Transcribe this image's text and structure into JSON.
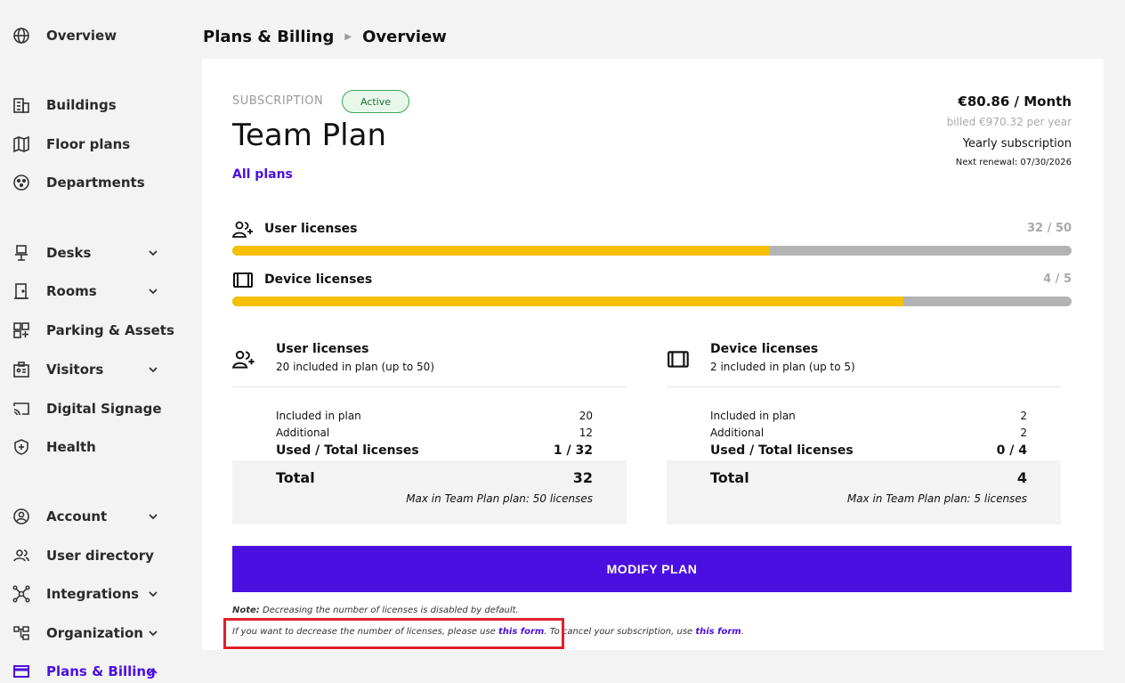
{
  "sidebar": {
    "items": [
      {
        "label": "Overview",
        "icon": "globe-icon",
        "chevron": false
      },
      {
        "label": "Buildings",
        "icon": "building-icon",
        "chevron": false
      },
      {
        "label": "Floor plans",
        "icon": "map-icon",
        "chevron": false
      },
      {
        "label": "Departments",
        "icon": "departments-icon",
        "chevron": false
      },
      {
        "label": "Desks",
        "icon": "desk-icon",
        "chevron": true
      },
      {
        "label": "Rooms",
        "icon": "room-icon",
        "chevron": true
      },
      {
        "label": "Parking & Assets",
        "icon": "parking-icon",
        "chevron": false
      },
      {
        "label": "Visitors",
        "icon": "visitors-icon",
        "chevron": true
      },
      {
        "label": "Digital Signage",
        "icon": "cast-icon",
        "chevron": false
      },
      {
        "label": "Health",
        "icon": "health-shield-icon",
        "chevron": false
      },
      {
        "label": "Account",
        "icon": "account-icon",
        "chevron": true
      },
      {
        "label": "User directory",
        "icon": "users-icon",
        "chevron": false
      },
      {
        "label": "Integrations",
        "icon": "integrations-icon",
        "chevron": true
      },
      {
        "label": "Organization",
        "icon": "organization-icon",
        "chevron": true
      },
      {
        "label": "Plans & Billing",
        "icon": "card-icon",
        "chevron": true
      }
    ]
  },
  "breadcrumb": {
    "parent": "Plans & Billing",
    "current": "Overview"
  },
  "subscription": {
    "label": "SUBSCRIPTION",
    "status": "Active",
    "plan_name": "Team Plan",
    "all_plans_link": "All plans",
    "price": "€80.86 / Month",
    "billed": "billed €970.32 per year",
    "term": "Yearly subscription",
    "renewal": "Next renewal: 07/30/2026"
  },
  "usage": {
    "user": {
      "label": "User licenses",
      "count": "32 / 50",
      "fill": 0.64
    },
    "device": {
      "label": "Device licenses",
      "count": "4 / 5",
      "fill": 0.8
    }
  },
  "user_section": {
    "title": "User licenses",
    "subtitle": "20 included in plan (up to 50)",
    "included_label": "Included in plan",
    "included_value": "20",
    "additional_label": "Additional",
    "additional_value": "12",
    "used_label": "Used / Total licenses",
    "used_value": "1 / 32",
    "total_label": "Total",
    "total_value": "32",
    "max_note": "Max in Team Plan plan: 50 licenses"
  },
  "device_section": {
    "title": "Device licenses",
    "subtitle": "2 included in plan (up to 5)",
    "included_label": "Included in plan",
    "included_value": "2",
    "additional_label": "Additional",
    "additional_value": "2",
    "used_label": "Used / Total licenses",
    "used_value": "0 / 4",
    "total_label": "Total",
    "total_value": "4",
    "max_note": "Max in Team Plan plan: 5 licenses"
  },
  "modify_button": "MODIFY PLAN",
  "notes": {
    "note_prefix": "Note:",
    "note_text": " Decreasing the number of licenses is disabled by default.",
    "line2_a": "If you want to decrease the number of licenses, please use ",
    "link1": "this form",
    "line2_b": ". To cancel your subscription, use ",
    "link2": "this form",
    "line2_c": "."
  },
  "colors": {
    "accent": "#4b10e0",
    "progress": "#f5c000",
    "active_badge": "#3fa45b"
  }
}
